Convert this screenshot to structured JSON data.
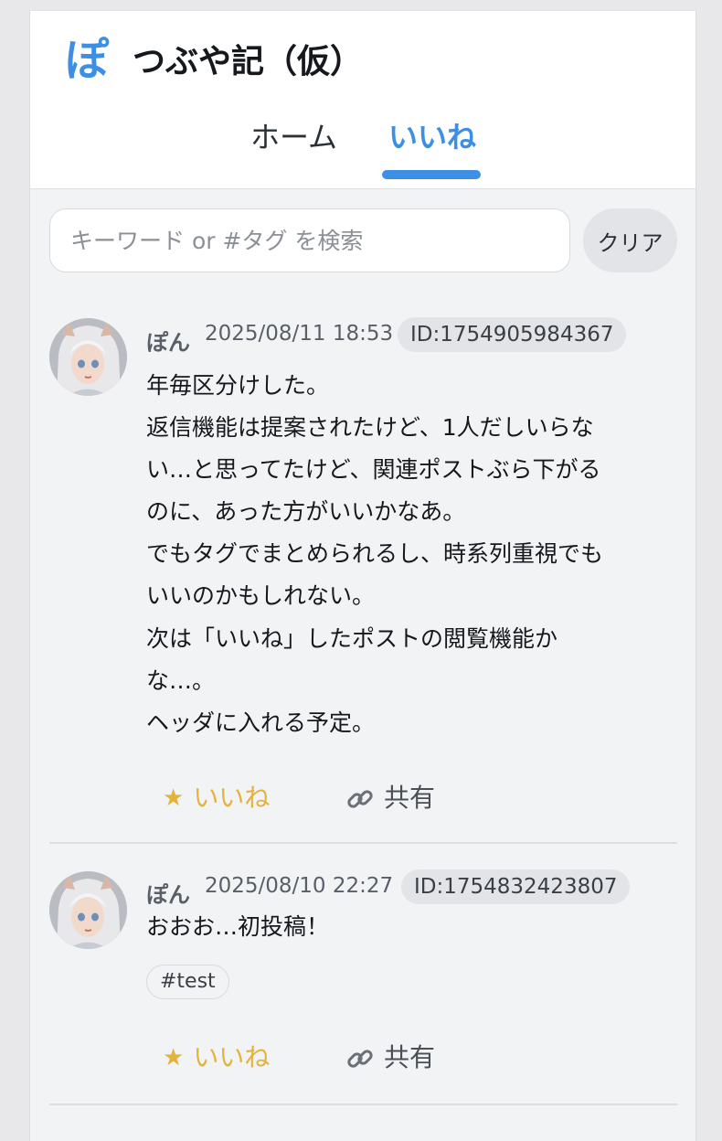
{
  "header": {
    "logo": "ぽ",
    "title": "つぶや記（仮）",
    "tabs": [
      {
        "label": "ホーム",
        "active": false
      },
      {
        "label": "いいね",
        "active": true
      }
    ],
    "accent_color": "#3d8fe6"
  },
  "search": {
    "placeholder": "キーワード or #タグ を検索",
    "value": "",
    "clear_label": "クリア"
  },
  "posts": [
    {
      "author": "ぽん",
      "timestamp": "2025/08/11 18:53",
      "id_label": "ID:1754905984367",
      "lines": [
        "年毎区分けした。",
        "返信機能は提案されたけど、1人だしいらな",
        "い…と思ってたけど、関連ポストぶら下がる",
        "のに、あった方がいいかなあ。",
        "でもタグでまとめられるし、時系列重視でも",
        "いいのかもしれない。",
        "次は「いいね」したポストの閲覧機能か",
        "な…。",
        "ヘッダに入れる予定。"
      ],
      "tags": [],
      "like_label": "いいね",
      "share_label": "共有"
    },
    {
      "author": "ぽん",
      "timestamp": "2025/08/10 22:27",
      "id_label": "ID:1754832423807",
      "lines": [
        "おおお…初投稿！"
      ],
      "tags": [
        "#test"
      ],
      "like_label": "いいね",
      "share_label": "共有"
    }
  ],
  "icons": {
    "like": "star-icon",
    "share": "link-icon",
    "like_color": "#e3b33c"
  }
}
